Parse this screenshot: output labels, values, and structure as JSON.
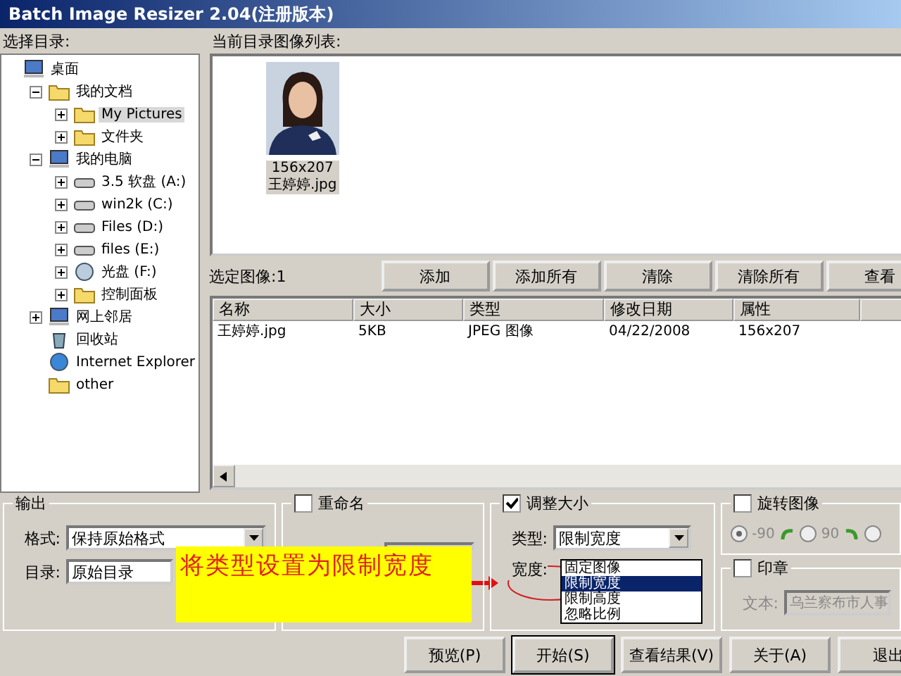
{
  "window": {
    "title": "Batch Image Resizer 2.04(注册版本)"
  },
  "folder_pane": {
    "label": "选择目录:",
    "tree": [
      {
        "label": "桌面",
        "kind": "desktop",
        "selected": false,
        "children": [
          {
            "label": "我的文档",
            "kind": "docs",
            "expanded": true,
            "selected": false,
            "children": [
              {
                "label": "My Pictures",
                "kind": "pictures",
                "expanded": false,
                "selected": true
              },
              {
                "label": "文件夹",
                "kind": "folder",
                "expanded": false,
                "selected": false
              }
            ]
          },
          {
            "label": "我的电脑",
            "kind": "computer",
            "expanded": true,
            "selected": false,
            "children": [
              {
                "label": "3.5 软盘 (A:)",
                "kind": "floppy",
                "expanded": false,
                "selected": false
              },
              {
                "label": "win2k (C:)",
                "kind": "drive",
                "expanded": false,
                "selected": false
              },
              {
                "label": "Files (D:)",
                "kind": "drive",
                "expanded": false,
                "selected": false
              },
              {
                "label": "files (E:)",
                "kind": "drive",
                "expanded": false,
                "selected": false
              },
              {
                "label": "光盘 (F:)",
                "kind": "cd",
                "expanded": false,
                "selected": false
              },
              {
                "label": "控制面板",
                "kind": "control",
                "expanded": false,
                "selected": false
              }
            ]
          },
          {
            "label": "网上邻居",
            "kind": "network",
            "expanded": false,
            "selected": false
          },
          {
            "label": "回收站",
            "kind": "recycle",
            "selected": false
          },
          {
            "label": "Internet Explorer",
            "kind": "ie",
            "selected": false
          },
          {
            "label": "other",
            "kind": "folder",
            "selected": false
          }
        ]
      }
    ]
  },
  "image_list": {
    "label": "当前目录图像列表:",
    "items": [
      {
        "kind": "picture",
        "size": "156x207",
        "name": "王婷婷.jpg"
      }
    ]
  },
  "selection": {
    "label": "选定图像:1",
    "buttons": [
      "添加",
      "添加所有",
      "清除",
      "清除所有",
      "查看"
    ]
  },
  "table": {
    "columns": [
      "名称",
      "大小",
      "类型",
      "修改日期",
      "属性"
    ],
    "rows": [
      [
        "王婷婷.jpg",
        "5KB",
        "JPEG 图像",
        "04/22/2008",
        "156x207"
      ]
    ]
  },
  "output": {
    "title": "输出",
    "fields": [
      {
        "label": "格式:",
        "value": "保持原始格式",
        "kind": "dropdown"
      },
      {
        "label": "目录:",
        "value": "原始目录",
        "kind": "text"
      }
    ]
  },
  "rename": {
    "title": "重命名",
    "checked": false
  },
  "resize": {
    "title": "调整大小",
    "checked": true,
    "type_label": "类型:",
    "type_value": "限制宽度",
    "width_label": "宽度:",
    "options": [
      {
        "label": "固定图像",
        "selected": false
      },
      {
        "label": "限制宽度",
        "selected": true
      },
      {
        "label": "限制高度",
        "selected": false
      },
      {
        "label": "忽略比例",
        "selected": false
      }
    ]
  },
  "rotate": {
    "title": "旋转图像",
    "checked": false,
    "options": [
      {
        "label": "-90",
        "selected": true
      },
      {
        "label": "90",
        "selected": false
      },
      {
        "selected": false
      }
    ]
  },
  "stamp": {
    "title": "印章",
    "checked": false,
    "text_label": "文本:",
    "text_value": "乌兰察布市人事"
  },
  "buttons": [
    "预览(P)",
    "开始(S)",
    "查看结果(V)",
    "关于(A)",
    "退出"
  ],
  "annotation": {
    "text": "将类型设置为限制宽度"
  }
}
